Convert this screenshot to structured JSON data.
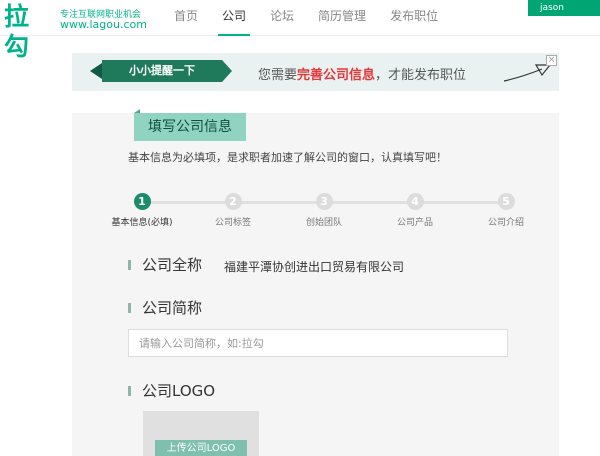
{
  "header": {
    "logo_main": "拉勾",
    "logo_slogan": "专注互联网职业机会",
    "logo_url": "www.lagou.com",
    "nav": [
      "首页",
      "公司",
      "论坛",
      "简历管理",
      "发布职位"
    ],
    "active_nav": "公司",
    "user_name": "jason"
  },
  "banner": {
    "ribbon": "小小提醒一下",
    "text_before": "您需要",
    "text_highlight": "完善公司信息",
    "text_after": "，才能发布职位",
    "close": "×"
  },
  "form": {
    "title": "填写公司信息",
    "intro": "基本信息为必填项，是求职者加速了解公司的窗口，认真填写吧！",
    "steps": [
      {
        "num": "1",
        "label": "基本信息(必填)"
      },
      {
        "num": "2",
        "label": "公司标签"
      },
      {
        "num": "3",
        "label": "创始团队"
      },
      {
        "num": "4",
        "label": "公司产品"
      },
      {
        "num": "5",
        "label": "公司介绍"
      }
    ],
    "company_name_label": "公司全称",
    "company_name_value": "福建平潭协创进出口贸易有限公司",
    "short_name_label": "公司简称",
    "short_name_placeholder": "请输入公司简称，如:拉勾",
    "short_name_value": "",
    "logo_label": "公司LOGO",
    "upload_label": "上传公司LOGO"
  },
  "colors": {
    "brand": "#00b38a",
    "ribbon": "#1f7a5c",
    "tab": "#8fd3c0",
    "highlight": "#e4393c",
    "step_active": "#1d8c6a"
  }
}
